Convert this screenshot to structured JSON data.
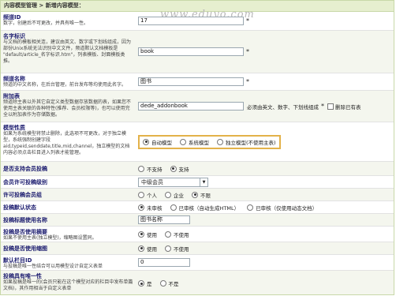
{
  "header": {
    "title": "内容模型管理 > 新增内容模型：",
    "watermark": "www.eduyo.com"
  },
  "channel_id": {
    "label": "频道ID",
    "desc": "数字，创建后不可更改，并具有唯一性。",
    "value": "17",
    "required": "*"
  },
  "name_id": {
    "label": "名字标识",
    "desc": "与文档的模板相关连，建议由英文、数字或下划线组成，因为部份Unix系统无法识别中文文件，频道默认文档模板是 \"default/article_名字标识.htm\"，列表模板、封面模板类推。",
    "value": "book",
    "required": "*"
  },
  "channel_name": {
    "label": "频道名称",
    "desc": "频道的中文名称，在后台管理，前台发布等均使用此名字。",
    "value": "图书",
    "required": "*"
  },
  "addon_table": {
    "label": "附加表",
    "desc": "频道除主表以外其它自定义类型数据存放数据的表，如果您不使用主表关联的各种特性(推荐、会员权限等)，也可以使用完全以附加表作为存储数据。",
    "value": "dede_addonbook",
    "hint": "必须由英文、数字、下划线组成",
    "required": "*",
    "delete_label": "删除已有表"
  },
  "model_type": {
    "label": "模型性质",
    "desc": "如果为系统模型将禁止删除，此选项不可更改，对于独立模型，系统强制创建字段aid,typeid,senddate,title,mid,channel，独立模型的文档内容必须点击栏目进入列表才能管理。",
    "options": [
      "自动模型",
      "系统模型",
      "独立模型(不使用主表)"
    ],
    "selected": 0
  },
  "support_member": {
    "label": "是否支持会员投稿",
    "options": [
      "不支持",
      "支持"
    ],
    "selected": 1
  },
  "member_level": {
    "label": "会员许可投稿级别",
    "value": "中级会员"
  },
  "member_group": {
    "label": "许可投稿会员组",
    "options": [
      "个人",
      "企业",
      "不限"
    ],
    "selected": 2
  },
  "default_status": {
    "label": "投稿默认状态",
    "options": [
      "未审核",
      "已审核（自动生成HTML）",
      "已审核（仅使用动态文档）"
    ],
    "selected": 0
  },
  "title_name": {
    "label": "投稿标题使用名称",
    "value": "图书名称"
  },
  "use_summary": {
    "label": "投稿是否使用摘要",
    "desc": "如果不使用主表(独立模型)，缩略图设置同。",
    "options": [
      "使用",
      "不使用"
    ],
    "selected": 0
  },
  "use_thumb": {
    "label": "投稿是否使用缩图",
    "options": [
      "使用",
      "不使用"
    ],
    "selected": 0
  },
  "default_column": {
    "label": "默认栏目ID",
    "desc": "与投稿是唯一性结合可以用模型设计自定义表单",
    "value": "0"
  },
  "unique": {
    "label": "投稿具有唯一性",
    "desc": "如果投稿是唯一的(会员只能在这个模型对应的栏目中发布单篇文档)，其作用相当于自定义表单",
    "options": [
      "是",
      "不是"
    ],
    "selected": 0
  }
}
